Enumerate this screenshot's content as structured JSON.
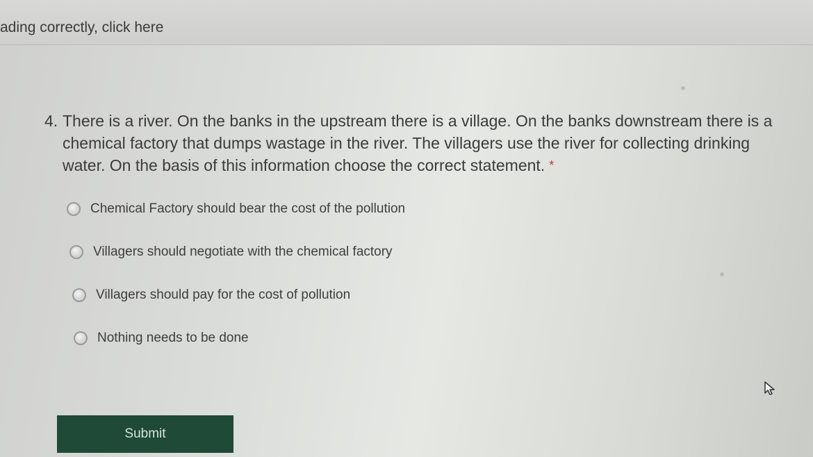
{
  "banner": {
    "text": "ading correctly, click here"
  },
  "question": {
    "number": "4.",
    "text": "There is a river. On the banks in the upstream there is a village. On the banks downstream there is a chemical factory that dumps wastage in the river. The villagers use the river for collecting drinking water. On the basis of this information choose the correct statement.",
    "required_marker": "*"
  },
  "options": [
    {
      "label": "Chemical Factory should bear the cost of the pollution",
      "selected": false
    },
    {
      "label": "Villagers should negotiate with the chemical factory",
      "selected": false
    },
    {
      "label": "Villagers should pay for the cost of pollution",
      "selected": false
    },
    {
      "label": "Nothing needs to be done",
      "selected": false
    }
  ],
  "form": {
    "submit_label": "Submit"
  },
  "colors": {
    "submit_background": "#1e4a37",
    "text": "#3b3b3b",
    "required": "#c0392b"
  },
  "icons": {
    "cursor": "mouse-pointer-icon"
  }
}
